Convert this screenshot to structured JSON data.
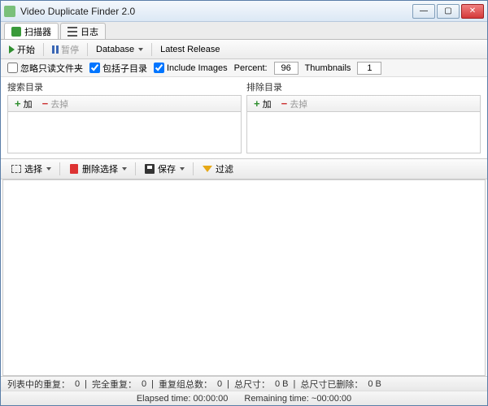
{
  "window": {
    "title": "Video Duplicate Finder 2.0"
  },
  "tabs": {
    "scanner": "扫描器",
    "log": "日志"
  },
  "toolbar": {
    "start": "开始",
    "pause": "暂停",
    "database": "Database",
    "latest": "Latest Release"
  },
  "options": {
    "ignoreReadonly": "忽略只读文件夹",
    "includeSubdirs": "包括子目录",
    "includeImages": "Include Images",
    "percentLabel": "Percent:",
    "percentValue": "96",
    "thumbsLabel": "Thumbnails",
    "thumbsValue": "1"
  },
  "dirs": {
    "searchHdr": "搜索目录",
    "excludeHdr": "排除目录",
    "add": "加",
    "remove": "去掉"
  },
  "midbar": {
    "select": "选择",
    "deleteSel": "删除选择",
    "save": "保存",
    "filter": "过滤"
  },
  "status": {
    "dupInList": "列表中的重复：",
    "dupInListV": "0",
    "fullDup": "完全重复：",
    "fullDupV": "0",
    "groups": "重复组总数：",
    "groupsV": "0",
    "totalSize": "总尺寸：",
    "totalSizeV": "0 B",
    "deletedSize": "总尺寸已删除：",
    "deletedSizeV": "0 B"
  },
  "time": {
    "elapsedLabel": "Elapsed time:",
    "elapsedV": "00:00:00",
    "remainingLabel": "Remaining time:",
    "remainingV": "~00:00:00"
  }
}
